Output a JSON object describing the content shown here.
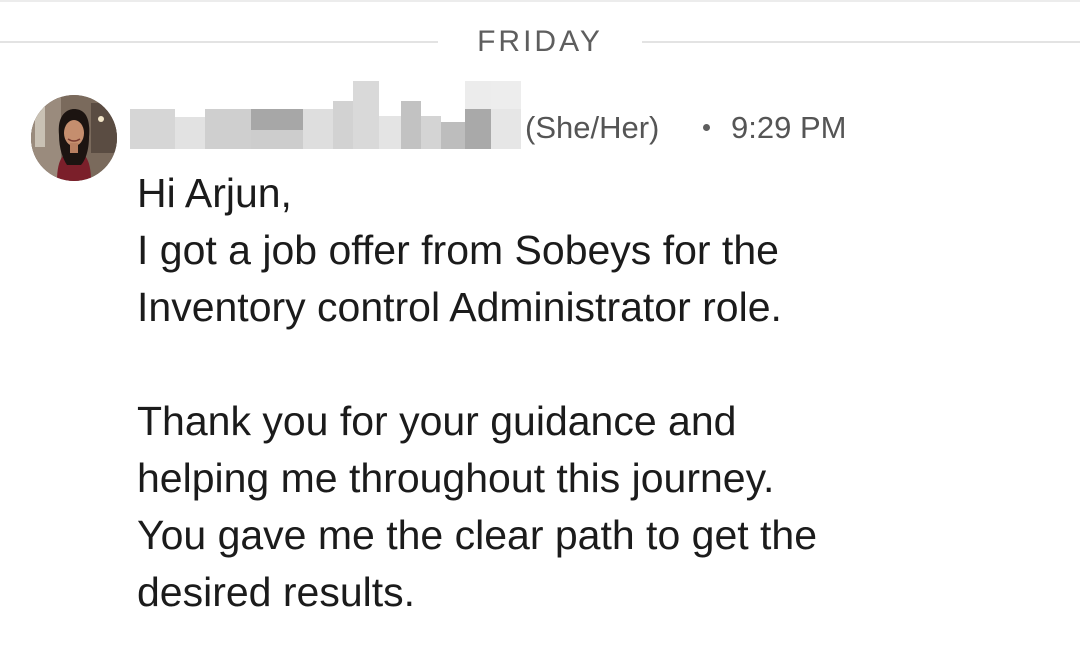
{
  "divider": {
    "day_label": "FRIDAY"
  },
  "sender": {
    "name_redacted": true,
    "avatar_icon": "profile-photo",
    "pronouns": "(She/Her)",
    "separator": "•",
    "time": "9:29 PM"
  },
  "message": {
    "lines": [
      "Hi Arjun,",
      "I got a job offer from Sobeys for the",
      "Inventory control Administrator role.",
      "",
      "Thank you for your guidance and",
      "helping me throughout this journey.",
      "You gave me the clear path to get the",
      "desired results."
    ]
  },
  "colors": {
    "background": "#ffffff",
    "text_primary": "#1b1b1b",
    "text_secondary": "#555555",
    "divider_line": "#e3e3e3"
  }
}
